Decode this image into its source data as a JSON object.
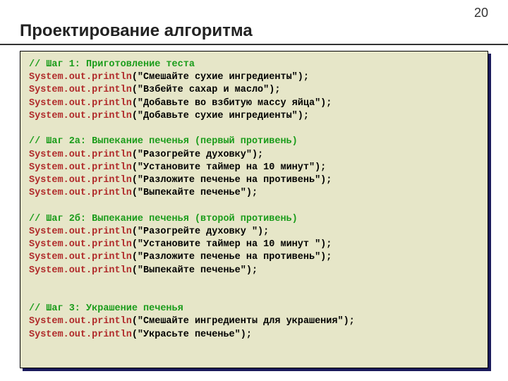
{
  "page_number": "20",
  "title": "Проектирование алгоритма",
  "code": {
    "c1": "// Шаг 1: Приготовление теста",
    "l1a": "System.out.println",
    "l1b": "(\"Смешайте сухие ингредиенты\");",
    "l2a": "System.out.println",
    "l2b": "(\"Взбейте сахар и масло\");",
    "l3a": "System.out.println",
    "l3b": "(\"Добавьте во взбитую массу яйца\");",
    "l4a": "System.out.println",
    "l4b": "(\"Добавьте сухие ингредиенты\");",
    "c2": "// Шаг 2а: Выпекание печенья (первый противень)",
    "l5a": "System.out.println",
    "l5b": "(\"Разогрейте духовку\");",
    "l6a": "System.out.println",
    "l6b": "(\"Установите таймер на 10 минут\");",
    "l7a": "System.out.println",
    "l7b": "(\"Разложите печенье на противень\");",
    "l8a": "System.out.println",
    "l8b": "(\"Выпекайте печенье\");",
    "c3": "// Шаг 2б: Выпекание печенья (второй противень)",
    "l9a": "System.out.println",
    "l9b": "(\"Разогрейте духовку \");",
    "l10a": "System.out.println",
    "l10b": "(\"Установите таймер на 10 минут \");",
    "l11a": "System.out.println",
    "l11b": "(\"Разложите печенье на противень\");",
    "l12a": "System.out.println",
    "l12b": "(\"Выпекайте печенье\");",
    "c4": "// Шаг 3: Украшение печенья",
    "l13a": "System.out.println",
    "l13b": "(\"Смешайте ингредиенты для украшения\");",
    "l14a": "System.out.println",
    "l14b": "(\"Украсьте печенье\");"
  }
}
